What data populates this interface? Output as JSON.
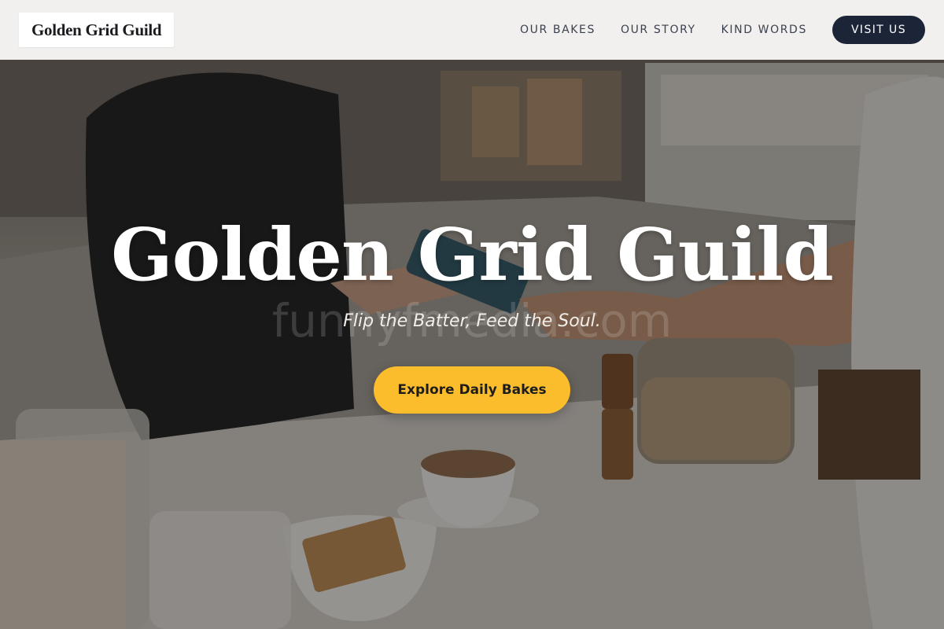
{
  "brand": {
    "name": "Golden Grid Guild"
  },
  "nav": {
    "links": [
      {
        "label": "OUR BAKES"
      },
      {
        "label": "OUR STORY"
      },
      {
        "label": "KIND WORDS"
      }
    ],
    "cta_label": "VISIT US"
  },
  "hero": {
    "title": "Golden Grid Guild",
    "tagline": "Flip the Batter, Feed the Soul.",
    "cta_label": "Explore Daily Bakes",
    "background_image": "bakery counter photo: barista taking card payment, latte art cup, coffee bag, jars",
    "watermark": "funnyfmedia.com"
  },
  "colors": {
    "header_bg": "#faf9f8",
    "nav_text": "#3c4150",
    "visit_button_bg": "#1c2538",
    "cta_bg": "#fbbd2c",
    "hero_text": "#ffffff"
  }
}
